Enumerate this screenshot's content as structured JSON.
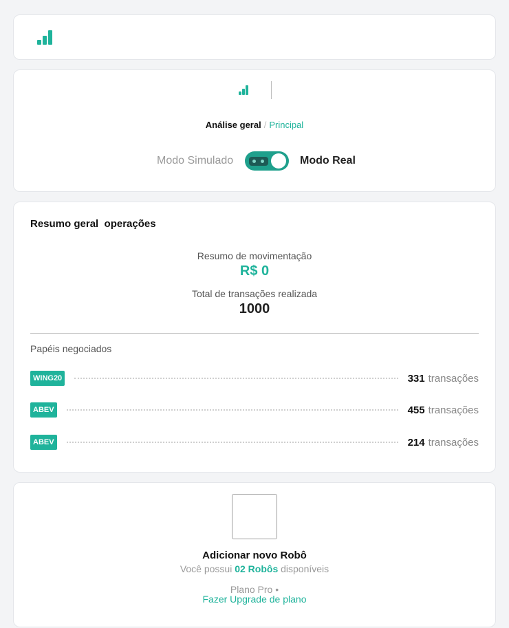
{
  "header": {
    "breadcrumb": {
      "current": "Análise geral",
      "separator": "/",
      "link": "Principal"
    },
    "mode": {
      "simulated_label": "Modo Simulado",
      "real_label": "Modo Real",
      "active": "real"
    }
  },
  "summary": {
    "title": "Resumo geral  operações",
    "movement_label": "Resumo de movimentação",
    "movement_value": "R$ 0",
    "transactions_label": "Total de transações realizada",
    "transactions_value": "1000",
    "papers_title": "Papéis negociados",
    "papers": [
      {
        "ticker": "WING20",
        "count": "331",
        "unit": "transações"
      },
      {
        "ticker": "ABEV",
        "count": "455",
        "unit": "transações"
      },
      {
        "ticker": "ABEV",
        "count": "214",
        "unit": "transações"
      }
    ]
  },
  "robot": {
    "title": "Adicionar novo Robô",
    "subtitle_prefix": "Você possui",
    "subtitle_highlight": "02 Robôs",
    "subtitle_suffix": "disponíveis",
    "plan": "Plano Pro •",
    "upgrade": "Fazer Upgrade de plano"
  },
  "colors": {
    "accent": "#1fb39b",
    "toggle": "#1fa08c"
  },
  "icons": {
    "logo": "signal-bars-icon",
    "toggle_face": "robot-face-icon"
  }
}
